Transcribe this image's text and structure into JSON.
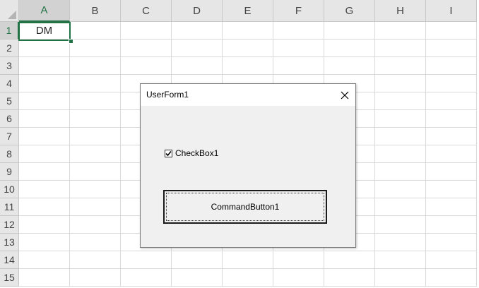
{
  "spreadsheet": {
    "columns": [
      "A",
      "B",
      "C",
      "D",
      "E",
      "F",
      "G",
      "H",
      "I"
    ],
    "rows": [
      "1",
      "2",
      "3",
      "4",
      "5",
      "6",
      "7",
      "8",
      "9",
      "10",
      "11",
      "12",
      "13",
      "14",
      "15"
    ],
    "active_cell": "A1",
    "cells": {
      "A1": "DM"
    },
    "accent_color": "#217346"
  },
  "userform": {
    "title": "UserForm1",
    "checkbox": {
      "label": "CheckBox1",
      "checked": true
    },
    "command_button": {
      "label": "CommandButton1"
    }
  }
}
